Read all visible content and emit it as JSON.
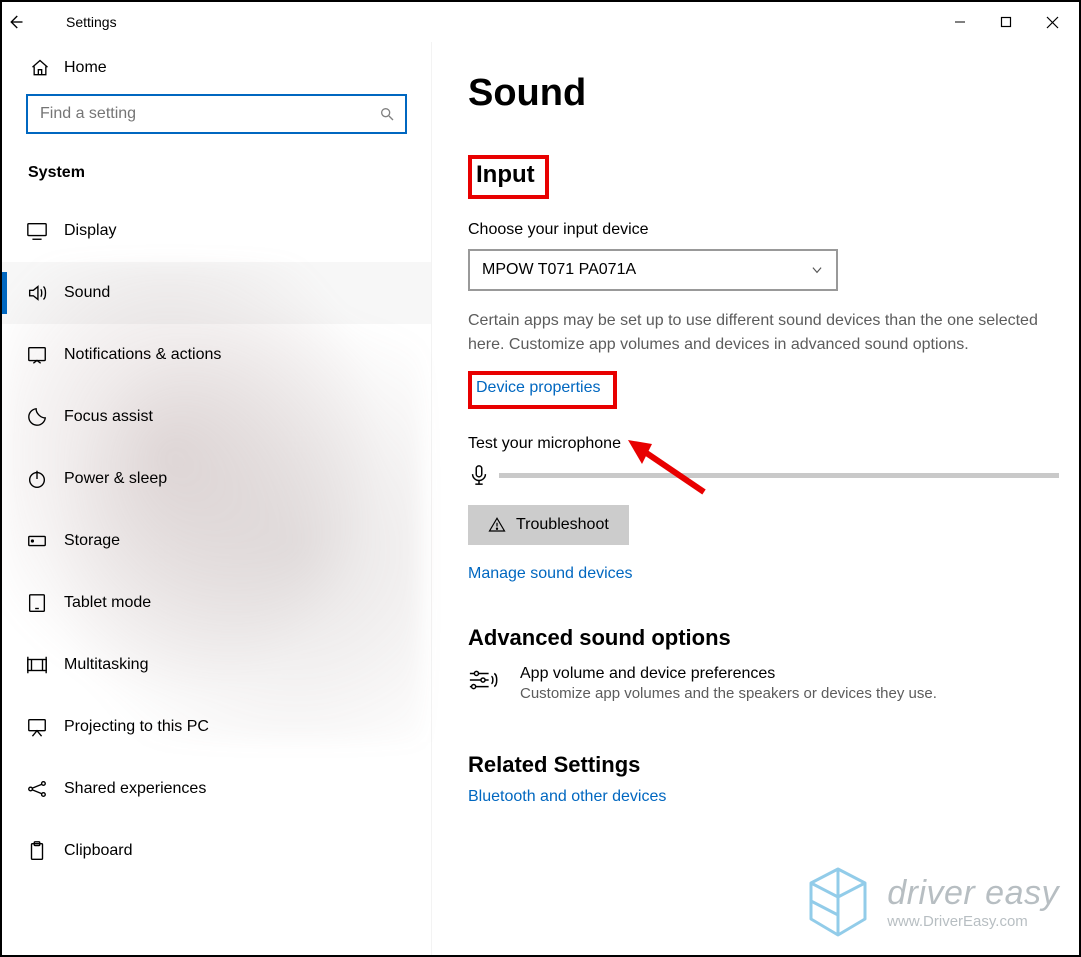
{
  "titlebar": {
    "title": "Settings"
  },
  "sidebar": {
    "home": "Home",
    "search_placeholder": "Find a setting",
    "category": "System",
    "items": [
      {
        "label": "Display"
      },
      {
        "label": "Sound"
      },
      {
        "label": "Notifications & actions"
      },
      {
        "label": "Focus assist"
      },
      {
        "label": "Power & sleep"
      },
      {
        "label": "Storage"
      },
      {
        "label": "Tablet mode"
      },
      {
        "label": "Multitasking"
      },
      {
        "label": "Projecting to this PC"
      },
      {
        "label": "Shared experiences"
      },
      {
        "label": "Clipboard"
      }
    ]
  },
  "main": {
    "page_title": "Sound",
    "input_heading": "Input",
    "choose_label": "Choose your input device",
    "device_selected": "MPOW T071 PA071A",
    "hint": "Certain apps may be set up to use different sound devices than the one selected here. Customize app volumes and devices in advanced sound options.",
    "device_properties": "Device properties",
    "test_label": "Test your microphone",
    "troubleshoot": "Troubleshoot",
    "manage_link": "Manage sound devices",
    "advanced_heading": "Advanced sound options",
    "adv_item_title": "App volume and device preferences",
    "adv_item_sub": "Customize app volumes and the speakers or devices they use.",
    "related_heading": "Related Settings",
    "related_link": "Bluetooth and other devices"
  },
  "watermark": {
    "brand": "driver easy",
    "url": "www.DriverEasy.com"
  }
}
